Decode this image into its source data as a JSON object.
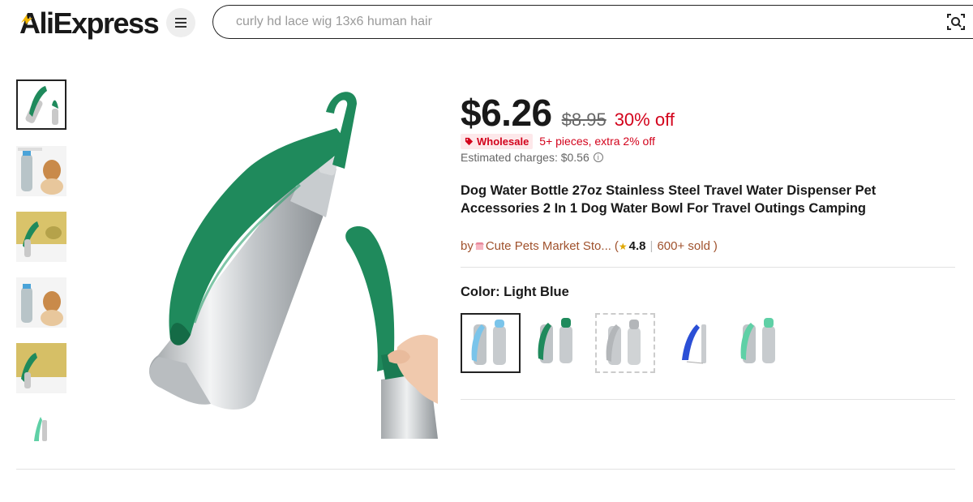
{
  "header": {
    "logo_text": "AliExpress",
    "search_placeholder": "curly hd lace wig 13x6 human hair"
  },
  "product": {
    "price": "$6.26",
    "original_price": "$8.95",
    "discount": "30% off",
    "wholesale_label": "Wholesale",
    "wholesale_text": "5+ pieces, extra 2% off",
    "estimated_charges": "Estimated charges: $0.56",
    "title": "Dog Water Bottle 27oz Stainless Steel Travel Water Dispenser Pet Accessories 2 In 1 Dog Water Bowl For Travel Outings Camping",
    "store": {
      "prefix": "by",
      "name": "Cute Pets Market Sto...",
      "open_paren": "(",
      "rating": "4.8",
      "separator": "|",
      "sold": "600+ sold",
      "close_paren": ")"
    },
    "color": {
      "label": "Color: Light Blue",
      "options": [
        "Light Blue",
        "Dark Green",
        "Gray",
        "Blue",
        "Mint Green"
      ],
      "selected_index": 0
    }
  },
  "colors": {
    "accent_red": "#d3031c",
    "store_brown": "#a0522d",
    "bottle_green": "#1f8a5c"
  }
}
